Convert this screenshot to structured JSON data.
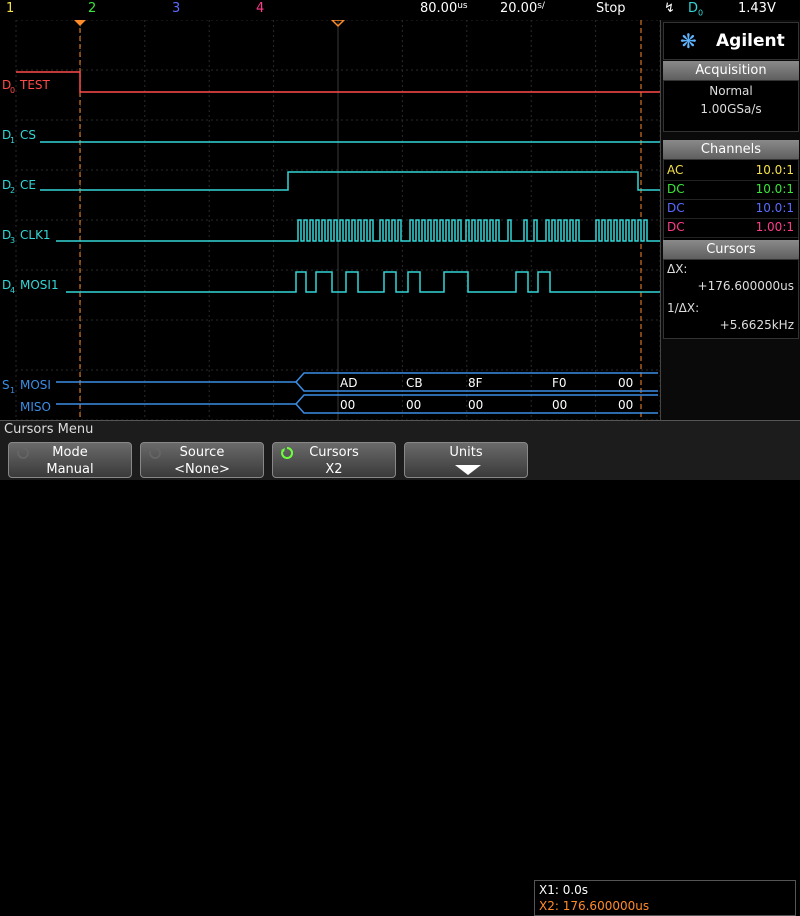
{
  "topbar": {
    "ch1": "1",
    "ch2": "2",
    "ch3": "3",
    "ch4": "4",
    "timebase": "80.00",
    "timebase_unit_top": "us",
    "delay": "20.00",
    "delay_unit": "s/",
    "run_state": "Stop",
    "trigger_source": "D",
    "trigger_source_sub": "0",
    "trigger_level": "1.43V"
  },
  "brand": {
    "name": "Agilent"
  },
  "acquisition": {
    "title": "Acquisition",
    "mode": "Normal",
    "rate": "1.00GSa/s"
  },
  "channels": {
    "title": "Channels",
    "rows": [
      {
        "coupling": "AC",
        "probe": "10.0:1",
        "color": "#f5e14a"
      },
      {
        "coupling": "DC",
        "probe": "10.0:1",
        "color": "#39e639"
      },
      {
        "coupling": "DC",
        "probe": "10.0:1",
        "color": "#5a6bff"
      },
      {
        "coupling": "DC",
        "probe": "1.00:1",
        "color": "#ff3b8a"
      }
    ]
  },
  "cursors_panel": {
    "title": "Cursors",
    "dx_label": "ΔX:",
    "dx_value": "+176.600000us",
    "inv_label": "1/ΔX:",
    "inv_value": "+5.6625kHz"
  },
  "digital": [
    {
      "id": "D",
      "sub": "0",
      "name": "TEST",
      "color": "#ff4a4a"
    },
    {
      "id": "D",
      "sub": "1",
      "name": "CS",
      "color": "#33d6d6"
    },
    {
      "id": "D",
      "sub": "2",
      "name": "CE",
      "color": "#33d6d6"
    },
    {
      "id": "D",
      "sub": "3",
      "name": "CLK1",
      "color": "#33d6d6"
    },
    {
      "id": "D",
      "sub": "4",
      "name": "MOSI1",
      "color": "#33d6d6"
    }
  ],
  "serial": {
    "id": "S",
    "sub": "1",
    "color": "#3a8ee6",
    "mosi_label": "MOSI",
    "miso_label": "MISO",
    "mosi_bytes": [
      "AD",
      "CB",
      "8F",
      "F0",
      "00"
    ],
    "miso_bytes": [
      "00",
      "00",
      "00",
      "00",
      "00"
    ]
  },
  "menu": {
    "title": "Cursors Menu"
  },
  "softkeys": [
    {
      "label": "Mode",
      "value": "Manual"
    },
    {
      "label": "Source",
      "value": "<None>"
    },
    {
      "label": "Cursors",
      "value": "X2"
    },
    {
      "label": "Units",
      "value": ""
    }
  ],
  "xinfo": {
    "x1": "X1: 0.0s",
    "x2": "X2: 176.600000us"
  },
  "colors": {
    "ch1": "#f5e14a",
    "ch2": "#39e639",
    "ch3": "#5a6bff",
    "ch4": "#ff3b8a",
    "cursor": "#ff8a2a",
    "trigger_marker": "#ff8a2a",
    "digital": "#33d6d6"
  }
}
